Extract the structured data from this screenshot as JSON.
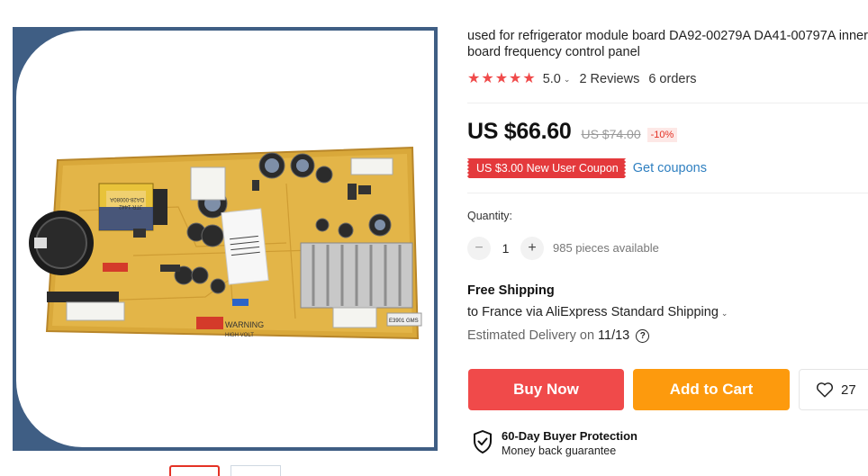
{
  "product": {
    "title": "used for refrigerator module board DA92-00279A DA41-00797A inner board frequency control panel",
    "rating": "5.0",
    "reviews": "2 Reviews",
    "orders": "6 orders",
    "image_text": {
      "warning": "WARNING",
      "warning_sub": "HIGH VOLT",
      "label_1": "DA28-00080A",
      "label_2": "JTR 1442",
      "cap_label": "E3901 GMS"
    }
  },
  "price": {
    "current": "US $66.60",
    "original": "US $74.00",
    "discount": "-10%"
  },
  "coupon": {
    "label": "US $3.00 New User Coupon",
    "link": "Get coupons"
  },
  "quantity": {
    "label": "Quantity:",
    "value": "1",
    "minus": "−",
    "plus": "+",
    "available": "985 pieces available"
  },
  "shipping": {
    "title": "Free Shipping",
    "line": "to France via AliExpress Standard Shipping",
    "delivery_label": "Estimated Delivery on",
    "delivery_date": "11/13",
    "help": "?"
  },
  "actions": {
    "buy_now": "Buy Now",
    "add_to_cart": "Add to Cart",
    "wishlist_count": "27"
  },
  "protection": {
    "title": "60-Day Buyer Protection",
    "subtitle": "Money back guarantee"
  },
  "colors": {
    "accent_red": "#f04a4a",
    "cart_orange": "#fd9a0d",
    "link_blue": "#2e7fc0",
    "frame_blue": "#3f5e84"
  }
}
